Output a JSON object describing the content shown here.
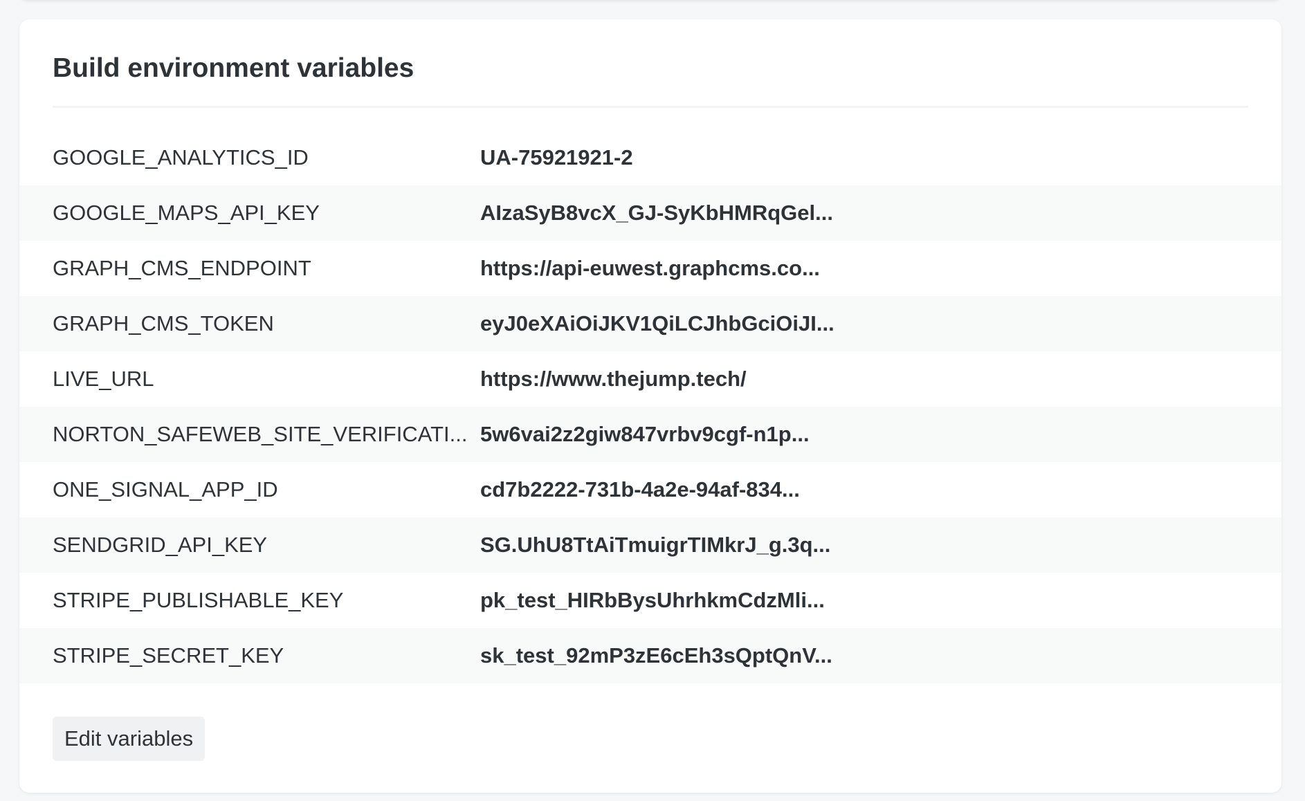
{
  "section": {
    "title": "Build environment variables",
    "edit_label": "Edit variables"
  },
  "variables": [
    {
      "key": "GOOGLE_ANALYTICS_ID",
      "value": "UA-75921921-2"
    },
    {
      "key": "GOOGLE_MAPS_API_KEY",
      "value": "AIzaSyB8vcX_GJ-SyKbHMRqGel..."
    },
    {
      "key": "GRAPH_CMS_ENDPOINT",
      "value": "https://api-euwest.graphcms.co..."
    },
    {
      "key": "GRAPH_CMS_TOKEN",
      "value": "eyJ0eXAiOiJKV1QiLCJhbGciOiJI..."
    },
    {
      "key": "LIVE_URL",
      "value": "https://www.thejump.tech/"
    },
    {
      "key": "NORTON_SAFEWEB_SITE_VERIFICATI...",
      "value": "5w6vai2z2giw847vrbv9cgf-n1p..."
    },
    {
      "key": "ONE_SIGNAL_APP_ID",
      "value": "cd7b2222-731b-4a2e-94af-834..."
    },
    {
      "key": "SENDGRID_API_KEY",
      "value": "SG.UhU8TtAiTmuigrTIMkrJ_g.3q..."
    },
    {
      "key": "STRIPE_PUBLISHABLE_KEY",
      "value": "pk_test_HIRbBysUhrhkmCdzMli..."
    },
    {
      "key": "STRIPE_SECRET_KEY",
      "value": "sk_test_92mP3zE6cEh3sQptQnV..."
    }
  ]
}
